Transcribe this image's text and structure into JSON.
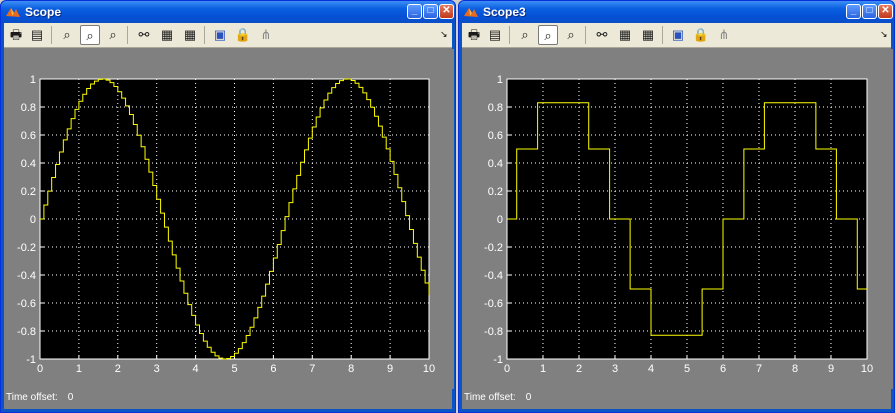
{
  "windows": [
    {
      "title": "Scope",
      "time_offset_label": "Time offset:",
      "time_offset_value": "0"
    },
    {
      "title": "Scope3",
      "time_offset_label": "Time offset:",
      "time_offset_value": "0"
    }
  ],
  "icons": [
    "print-icon",
    "parameters-icon",
    "zoom-icon",
    "zoom-x-icon",
    "zoom-y-icon",
    "autoscale-icon",
    "save-axes-icon",
    "restore-axes-icon",
    "floating-scope-icon",
    "lock-axes-icon",
    "signal-selector-icon"
  ],
  "colors": {
    "line": "#ffff00",
    "plot_bg": "#000000",
    "frame_bg": "#808080",
    "titlebar": "#0a5fe0"
  },
  "chart_data": [
    {
      "type": "line",
      "title": "",
      "xlabel": "",
      "ylabel": "",
      "xlim": [
        0,
        10
      ],
      "ylim": [
        -1,
        1
      ],
      "x_ticks": [
        0,
        1,
        2,
        3,
        4,
        5,
        6,
        7,
        8,
        9,
        10
      ],
      "y_ticks": [
        -1,
        -0.8,
        -0.6,
        -0.4,
        -0.2,
        0,
        0.2,
        0.4,
        0.6,
        0.8,
        1
      ],
      "grid": true,
      "step": 0.1,
      "series": [
        {
          "style": "stairs",
          "x": [
            0,
            0.1,
            0.2,
            0.3,
            0.4,
            0.5,
            0.6,
            0.7,
            0.8,
            0.9,
            1.0,
            1.1,
            1.2,
            1.3,
            1.4,
            1.5,
            1.6,
            1.7,
            1.8,
            1.9,
            2.0,
            2.1,
            2.2,
            2.3,
            2.4,
            2.5,
            2.6,
            2.7,
            2.8,
            2.9,
            3.0,
            3.1,
            3.2,
            3.3,
            3.4,
            3.5,
            3.6,
            3.7,
            3.8,
            3.9,
            4.0,
            4.1,
            4.2,
            4.3,
            4.4,
            4.5,
            4.6,
            4.7,
            4.8,
            4.9,
            5.0,
            5.1,
            5.2,
            5.3,
            5.4,
            5.5,
            5.6,
            5.7,
            5.8,
            5.9,
            6.0,
            6.1,
            6.2,
            6.3,
            6.4,
            6.5,
            6.6,
            6.7,
            6.8,
            6.9,
            7.0,
            7.1,
            7.2,
            7.3,
            7.4,
            7.5,
            7.6,
            7.7,
            7.8,
            7.9,
            8.0,
            8.1,
            8.2,
            8.3,
            8.4,
            8.5,
            8.6,
            8.7,
            8.8,
            8.9,
            9.0,
            9.1,
            9.2,
            9.3,
            9.4,
            9.5,
            9.6,
            9.7,
            9.8,
            9.9,
            10.0
          ],
          "y": [
            0,
            0.1,
            0.199,
            0.296,
            0.389,
            0.479,
            0.565,
            0.644,
            0.717,
            0.783,
            0.841,
            0.891,
            0.932,
            0.964,
            0.985,
            0.997,
            1.0,
            0.992,
            0.974,
            0.946,
            0.909,
            0.863,
            0.808,
            0.746,
            0.675,
            0.598,
            0.516,
            0.427,
            0.335,
            0.239,
            0.141,
            0.042,
            -0.058,
            -0.158,
            -0.256,
            -0.351,
            -0.443,
            -0.53,
            -0.612,
            -0.688,
            -0.757,
            -0.818,
            -0.872,
            -0.916,
            -0.952,
            -0.978,
            -0.994,
            -1.0,
            -0.996,
            -0.982,
            -0.959,
            -0.926,
            -0.883,
            -0.832,
            -0.773,
            -0.706,
            -0.631,
            -0.551,
            -0.465,
            -0.374,
            -0.279,
            -0.182,
            -0.083,
            0.017,
            0.117,
            0.215,
            0.312,
            0.405,
            0.494,
            0.578,
            0.657,
            0.729,
            0.794,
            0.85,
            0.899,
            0.938,
            0.968,
            0.988,
            0.999,
            1.0,
            0.989,
            0.97,
            0.94,
            0.901,
            0.853,
            0.798,
            0.734,
            0.663,
            0.585,
            0.501,
            0.412,
            0.319,
            0.223,
            0.124,
            0.024,
            -0.075,
            -0.174,
            -0.272,
            -0.366,
            -0.457,
            -0.544
          ]
        }
      ]
    },
    {
      "type": "line",
      "title": "",
      "xlabel": "",
      "ylabel": "",
      "xlim": [
        0,
        10
      ],
      "ylim": [
        -1,
        1
      ],
      "x_ticks": [
        0,
        1,
        2,
        3,
        4,
        5,
        6,
        7,
        8,
        9,
        10
      ],
      "y_ticks": [
        -1,
        -0.8,
        -0.6,
        -0.4,
        -0.2,
        0,
        0.2,
        0.4,
        0.6,
        0.8,
        1
      ],
      "grid": true,
      "series": [
        {
          "style": "stairs",
          "x": [
            0,
            0.27,
            0.85,
            2.27,
            2.85,
            3.42,
            4.0,
            5.42,
            6.0,
            6.58,
            7.15,
            8.58,
            9.15,
            9.73,
            10.0
          ],
          "y": [
            0,
            0.5,
            0.83,
            0.5,
            0,
            -0.5,
            -0.83,
            -0.5,
            0,
            0.5,
            0.83,
            0.5,
            0,
            -0.5,
            -0.5
          ]
        }
      ]
    }
  ]
}
